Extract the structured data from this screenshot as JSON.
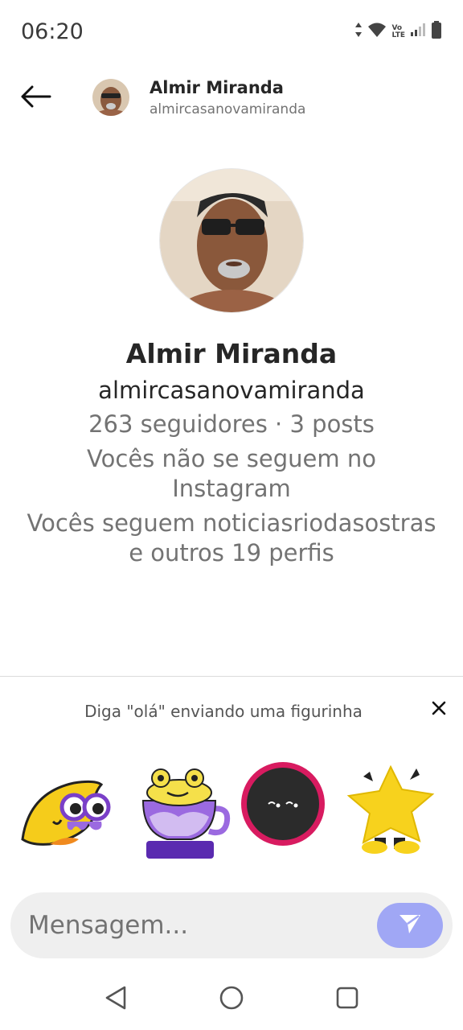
{
  "status_bar": {
    "time": "06:20",
    "network_label_top": "Vo",
    "network_label_bottom": "LTE",
    "icons": [
      "data-arrows-icon",
      "wifi-icon",
      "volte-icon",
      "signal-icon",
      "battery-icon"
    ]
  },
  "header": {
    "back_icon": "arrow-left-icon",
    "name": "Almir Miranda",
    "username": "almircasanovamiranda"
  },
  "profile": {
    "name": "Almir Miranda",
    "username": "almircasanovamiranda",
    "stats": "263 seguidores · 3 posts",
    "follow_status": "Vocês não se seguem no Instagram",
    "mutual": "Vocês seguem noticiasriodasostras e outros 19 perfis"
  },
  "sticker_section": {
    "prompt": "Diga \"olá\" enviando uma figurinha",
    "close_icon": "close-icon",
    "stickers": [
      {
        "name": "leaf-eyes-sticker"
      },
      {
        "name": "frog-cup-sticker"
      },
      {
        "name": "dark-blob-sticker"
      },
      {
        "name": "yellow-star-sticker"
      }
    ]
  },
  "composer": {
    "placeholder": "Mensagem...",
    "send_icon": "send-icon",
    "send_color": "#a0a7f5"
  },
  "nav_bar": {
    "icons": [
      "back-triangle-icon",
      "home-circle-icon",
      "recents-square-icon"
    ]
  }
}
